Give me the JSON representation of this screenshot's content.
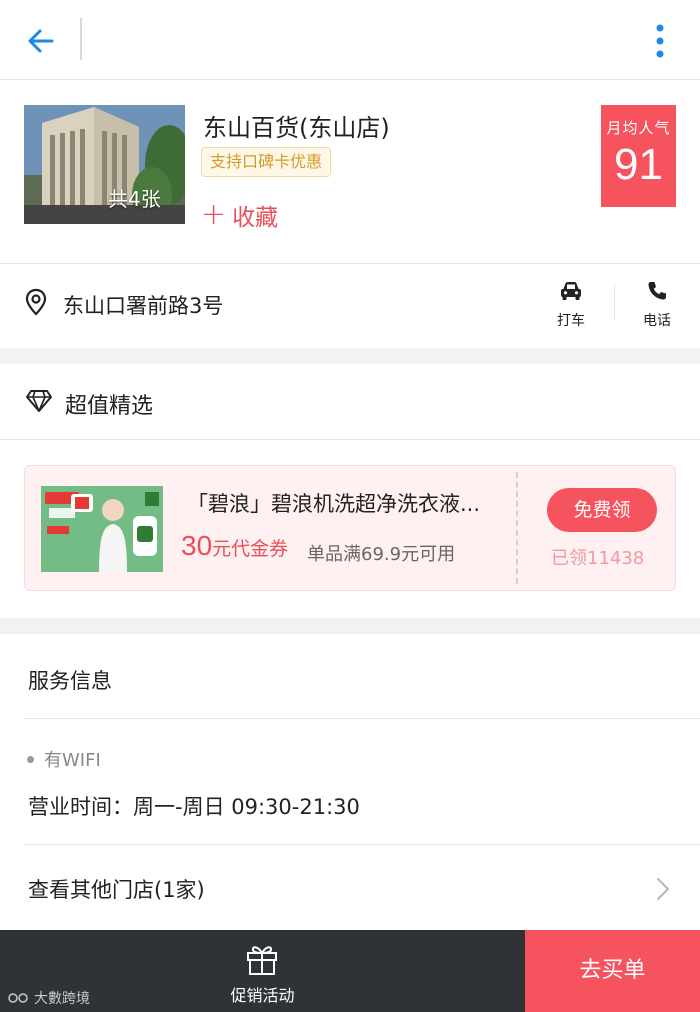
{
  "topbar": {
    "back_icon": "arrow-left-icon",
    "more_icon": "more-vertical-icon"
  },
  "store": {
    "name": "东山百货(东山店)",
    "photo_count_label": "共4张",
    "tag": "支持口碑卡优惠",
    "favorite_label": "收藏",
    "popularity_label": "月均人气",
    "popularity_value": "91"
  },
  "address": {
    "text": "东山口署前路3号",
    "taxi_label": "打车",
    "call_label": "电话"
  },
  "deals": {
    "title": "超值精选",
    "coupon": {
      "title": "「碧浪」碧浪机洗超净洗衣液...",
      "amount": "30",
      "amount_unit": "元代金券",
      "condition": "单品满69.9元可用",
      "claim_label": "免费领",
      "claimed_text": "已领11438"
    }
  },
  "service": {
    "title": "服务信息",
    "wifi": "有WIFI",
    "hours": "营业时间：周一-周日 09:30-21:30",
    "other_stores": "查看其他门店(1家)"
  },
  "bottom_bar": {
    "promo_label": "促销活动",
    "buy_label": "去买单",
    "watermark": "大數跨境"
  },
  "colors": {
    "accent": "#f5545f",
    "link_blue": "#1e88e5",
    "tag_gold": "#d49a2e",
    "bar_dark": "#2f3237"
  }
}
